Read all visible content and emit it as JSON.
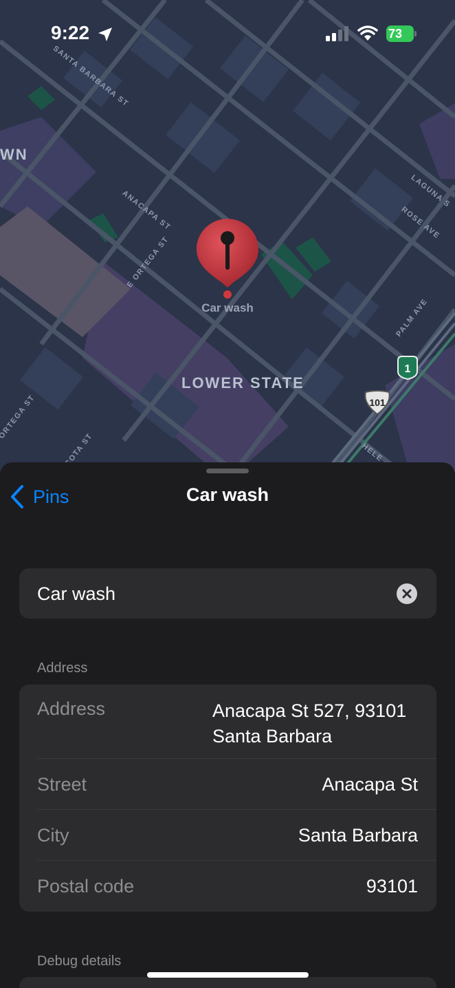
{
  "status_bar": {
    "time": "9:22",
    "battery_level": "73",
    "battery_color": "#34c759",
    "icons": [
      "location-arrow-icon",
      "signal-icon",
      "wifi-icon",
      "battery-charging-icon"
    ]
  },
  "map": {
    "district_labels": {
      "downtown_fragment": "WN",
      "lower_state": "LOWER STATE"
    },
    "street_labels": {
      "santa_barbara": "SANTA BARBARA ST",
      "anacapa": "ANACAPA ST",
      "e_ortega": "E ORTEGA ST",
      "laguna": "LAGUNA S",
      "rose_ave": "ROSE AVE",
      "palm_ave": "PALM AVE",
      "ortega_left": "ORTEGA ST",
      "cota": "COTA ST",
      "helena": "HELE"
    },
    "pin_label": "Car wash",
    "pin_color": "#c8373f",
    "route_shields": [
      "1",
      "101"
    ]
  },
  "sheet": {
    "back_label": "Pins",
    "title": "Car wash",
    "name_value": "Car wash",
    "address_section_header": "Address",
    "address_rows": {
      "address": {
        "label": "Address",
        "value_line1": "Anacapa St 527, 93101",
        "value_line2": "Santa Barbara"
      },
      "street": {
        "label": "Street",
        "value": "Anacapa St"
      },
      "city": {
        "label": "City",
        "value": "Santa Barbara"
      },
      "postal": {
        "label": "Postal code",
        "value": "93101"
      }
    },
    "debug_section_header": "Debug details",
    "accent_color": "#0a84ff"
  }
}
